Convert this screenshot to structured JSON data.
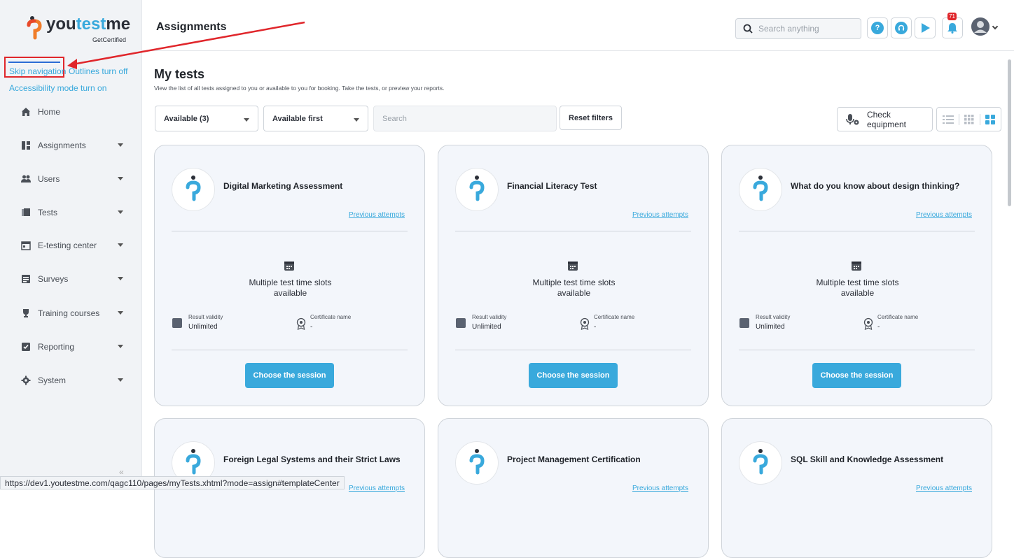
{
  "brand": {
    "name_prefix": "you",
    "name_accent": "test",
    "name_suffix": "me",
    "tagline": "GetCertified"
  },
  "accessibility": {
    "skip_navigation": "Skip navigation",
    "outlines": "Outlines turn off",
    "accessibility_mode": "Accessibility mode turn on"
  },
  "sidebar": {
    "items": [
      {
        "label": "Home",
        "icon": "home-icon"
      },
      {
        "label": "Assignments",
        "icon": "assignments-icon"
      },
      {
        "label": "Users",
        "icon": "users-icon"
      },
      {
        "label": "Tests",
        "icon": "tests-icon"
      },
      {
        "label": "E-testing center",
        "icon": "calendar-icon"
      },
      {
        "label": "Surveys",
        "icon": "survey-icon"
      },
      {
        "label": "Training courses",
        "icon": "trophy-icon"
      },
      {
        "label": "Reporting",
        "icon": "reporting-icon"
      },
      {
        "label": "System",
        "icon": "gear-icon"
      }
    ]
  },
  "header": {
    "title": "Assignments",
    "search_placeholder": "Search anything",
    "help_label": "?",
    "notification_count": "71"
  },
  "main": {
    "title": "My tests",
    "subtitle": "View the list of all tests assigned to you or available to you for booking. Take the tests, or preview your reports.",
    "filters": {
      "status": "Available (3)",
      "sort": "Available first",
      "search_placeholder": "Search",
      "reset": "Reset filters",
      "check_equipment": "Check equipment"
    }
  },
  "cards": [
    {
      "title": "Digital Marketing Assessment",
      "previous": "Previous attempts",
      "slots": "Multiple test time slots available",
      "rv_label": "Result validity",
      "rv_value": "Unlimited",
      "cn_label": "Certificate name",
      "cn_value": "-",
      "button": "Choose the session"
    },
    {
      "title": "Financial Literacy Test",
      "previous": "Previous attempts",
      "slots": "Multiple test time slots available",
      "rv_label": "Result validity",
      "rv_value": "Unlimited",
      "cn_label": "Certificate name",
      "cn_value": "-",
      "button": "Choose the session"
    },
    {
      "title": "What do you know about design thinking?",
      "previous": "Previous attempts",
      "slots": "Multiple test time slots available",
      "rv_label": "Result validity",
      "rv_value": "Unlimited",
      "cn_label": "Certificate name",
      "cn_value": "-",
      "button": "Choose the session"
    },
    {
      "title": "Foreign Legal Systems and their Strict Laws",
      "previous": "Previous attempts"
    },
    {
      "title": "Project Management Certification",
      "previous": "Previous attempts"
    },
    {
      "title": "SQL Skill and Knowledge Assessment",
      "previous": "Previous attempts"
    }
  ],
  "status_url": "https://dev1.youtestme.com/qagc110/pages/myTests.xhtml?mode=assign#templateCenter",
  "colors": {
    "accent": "#39a9dc",
    "annotation": "#e0262b"
  }
}
